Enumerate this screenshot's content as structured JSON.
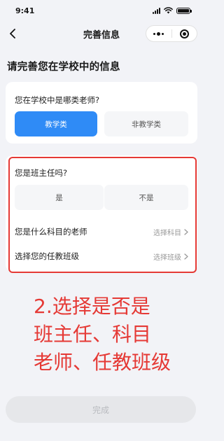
{
  "status_bar": {
    "time": "9:41",
    "battery_level": 1.0
  },
  "nav": {
    "title": "完善信息"
  },
  "page_heading": "请完善您在学校中的信息",
  "teacher_type": {
    "question": "您在学校中是哪类老师?",
    "options": [
      "教学类",
      "非教学类"
    ],
    "selected": "教学类"
  },
  "head_teacher": {
    "question": "您是班主任吗?",
    "options": [
      "是",
      "不是"
    ]
  },
  "subject_row": {
    "label": "您是什么科目的老师",
    "value": "选择科目"
  },
  "class_row": {
    "label": "选择您的任教班级",
    "value": "选择班级"
  },
  "annotation": {
    "lines": [
      "2.选择是否是",
      "班主任、科目",
      "老师、任教班级"
    ],
    "color": "#e53935"
  },
  "finish_button": "完成",
  "colors": {
    "accent": "#2f8bf6",
    "highlight": "#e53935",
    "background": "#f2f3f7"
  }
}
